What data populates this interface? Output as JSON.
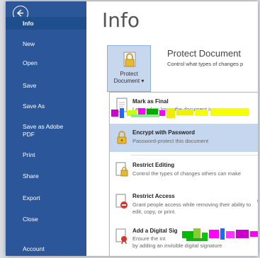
{
  "sidebar": {
    "items": [
      {
        "label": "Info"
      },
      {
        "label": "New"
      },
      {
        "label": "Open"
      },
      {
        "label": "Save"
      },
      {
        "label": "Save As"
      },
      {
        "label": "Save as Adobe\nPDF"
      },
      {
        "label": "Print"
      },
      {
        "label": "Share"
      },
      {
        "label": "Export"
      },
      {
        "label": "Close"
      },
      {
        "label": "Account"
      }
    ]
  },
  "main": {
    "title": "Info",
    "protect": {
      "button_line1": "Protect",
      "button_line2": "Document ▾",
      "title": "Protect Document",
      "description": "Control what types of changes p"
    }
  },
  "menu": {
    "items": [
      {
        "title": "Mark as Final",
        "desc": "Let readers know the document is"
      },
      {
        "title": "Encrypt with Password",
        "desc": "Password-protect this document"
      },
      {
        "title": "Restrict Editing",
        "desc": "Control the types of changes others can make"
      },
      {
        "title": "Restrict Access",
        "desc": "Grant people access while removing their ability to edit, copy, or print."
      },
      {
        "title": "Add a Digital Sig",
        "desc": "Ensure the int",
        "desc2": "by adding an invisible digital signature"
      }
    ]
  },
  "colors": {
    "sidebar": "#2b579a",
    "highlight": "#c5d7ee",
    "accent": "#8fb0d9"
  }
}
